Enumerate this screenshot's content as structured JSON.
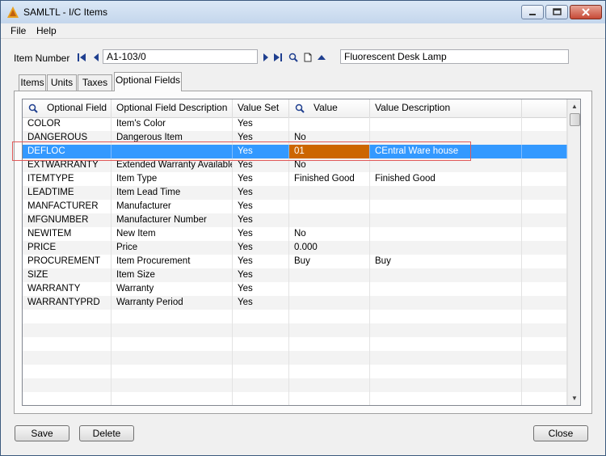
{
  "window": {
    "title": "SAMLTL - I/C Items"
  },
  "menu": {
    "file": "File",
    "help": "Help"
  },
  "item": {
    "label": "Item Number",
    "number": "A1-103/0",
    "description": "Fluorescent Desk Lamp"
  },
  "tabs": [
    {
      "label": "Items"
    },
    {
      "label": "Units"
    },
    {
      "label": "Taxes"
    },
    {
      "label": "Optional Fields"
    }
  ],
  "grid": {
    "columns": [
      "Optional Field",
      "Optional Field Description",
      "Value Set",
      "Value",
      "Value Description"
    ],
    "rows": [
      {
        "field": "COLOR",
        "desc": "Item's Color",
        "set": "Yes",
        "value": "",
        "vdesc": ""
      },
      {
        "field": "DANGEROUS",
        "desc": "Dangerous Item",
        "set": "Yes",
        "value": "No",
        "vdesc": ""
      },
      {
        "field": "DEFLOC",
        "desc": "",
        "set": "Yes",
        "value": "01",
        "vdesc": "CEntral Ware house"
      },
      {
        "field": "EXTWARRANTY",
        "desc": "Extended Warranty Available",
        "set": "Yes",
        "value": "No",
        "vdesc": ""
      },
      {
        "field": "ITEMTYPE",
        "desc": "Item Type",
        "set": "Yes",
        "value": "Finished Good",
        "vdesc": "Finished Good"
      },
      {
        "field": "LEADTIME",
        "desc": "Item Lead Time",
        "set": "Yes",
        "value": "",
        "vdesc": ""
      },
      {
        "field": "MANFACTURER",
        "desc": "Manufacturer",
        "set": "Yes",
        "value": "",
        "vdesc": ""
      },
      {
        "field": "MFGNUMBER",
        "desc": "Manufacturer Number",
        "set": "Yes",
        "value": "",
        "vdesc": ""
      },
      {
        "field": "NEWITEM",
        "desc": "New Item",
        "set": "Yes",
        "value": "No",
        "vdesc": ""
      },
      {
        "field": "PRICE",
        "desc": "Price",
        "set": "Yes",
        "value": "0.000",
        "vdesc": ""
      },
      {
        "field": "PROCUREMENT",
        "desc": "Item Procurement",
        "set": "Yes",
        "value": "Buy",
        "vdesc": "Buy"
      },
      {
        "field": "SIZE",
        "desc": "Item Size",
        "set": "Yes",
        "value": "",
        "vdesc": ""
      },
      {
        "field": "WARRANTY",
        "desc": "Warranty",
        "set": "Yes",
        "value": "",
        "vdesc": ""
      },
      {
        "field": "WARRANTYPRD",
        "desc": "Warranty Period",
        "set": "Yes",
        "value": "",
        "vdesc": ""
      }
    ]
  },
  "buttons": {
    "save": "Save",
    "delete": "Delete",
    "close": "Close"
  },
  "icons": {
    "app": "sage-logo-icon",
    "first": "first-record-icon",
    "prev": "previous-record-icon",
    "next": "next-record-icon",
    "last": "last-record-icon",
    "finder": "search-icon",
    "new": "new-document-icon",
    "zoom": "zoom-up-icon"
  },
  "colors": {
    "selection": "#3399ff",
    "value_highlight": "#cc6600",
    "outline": "#e05a5a"
  }
}
